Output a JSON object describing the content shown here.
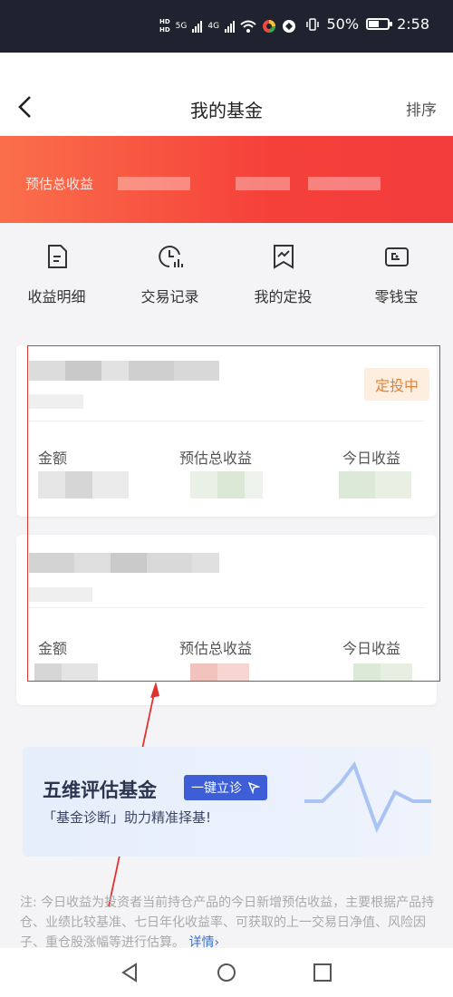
{
  "status_bar": {
    "network1": "5G",
    "network2": "4G",
    "battery": "50%",
    "time": "2:58"
  },
  "header": {
    "title": "我的基金",
    "sort_label": "排序"
  },
  "banner": {
    "label": "预估总收益"
  },
  "quick_actions": [
    {
      "label": "收益明细",
      "icon": "document-icon"
    },
    {
      "label": "交易记录",
      "icon": "clock-chart-icon"
    },
    {
      "label": "我的定投",
      "icon": "bookmark-trend-icon"
    },
    {
      "label": "零钱宝",
      "icon": "wallet-icon"
    }
  ],
  "cards": [
    {
      "tag": "定投中",
      "col1": "金额",
      "col2": "预估总收益",
      "col3": "今日收益"
    },
    {
      "col1": "金额",
      "col2": "预估总收益",
      "col3": "今日收益"
    }
  ],
  "promo": {
    "title": "五维评估基金",
    "button": "一键立诊",
    "subtitle": "「基金诊断」助力精准择基!"
  },
  "note": {
    "text": "注: 今日收益为投资者当前持仓产品的今日新增预估收益，主要根据产品持仓、业绩比较基准、七日年化收益率、可获取的上一交易日净值、风险因子、重仓股涨幅等进行估算。",
    "link": "详情›"
  },
  "colors": {
    "status_bg": "#1f2330",
    "banner_start": "#fa6f4b",
    "banner_end": "#f23c3c",
    "tag_bg": "#fdeee0",
    "tag_text": "#e2823a",
    "promo_button": "#3d5ed6",
    "annotation": "#e0332f"
  }
}
